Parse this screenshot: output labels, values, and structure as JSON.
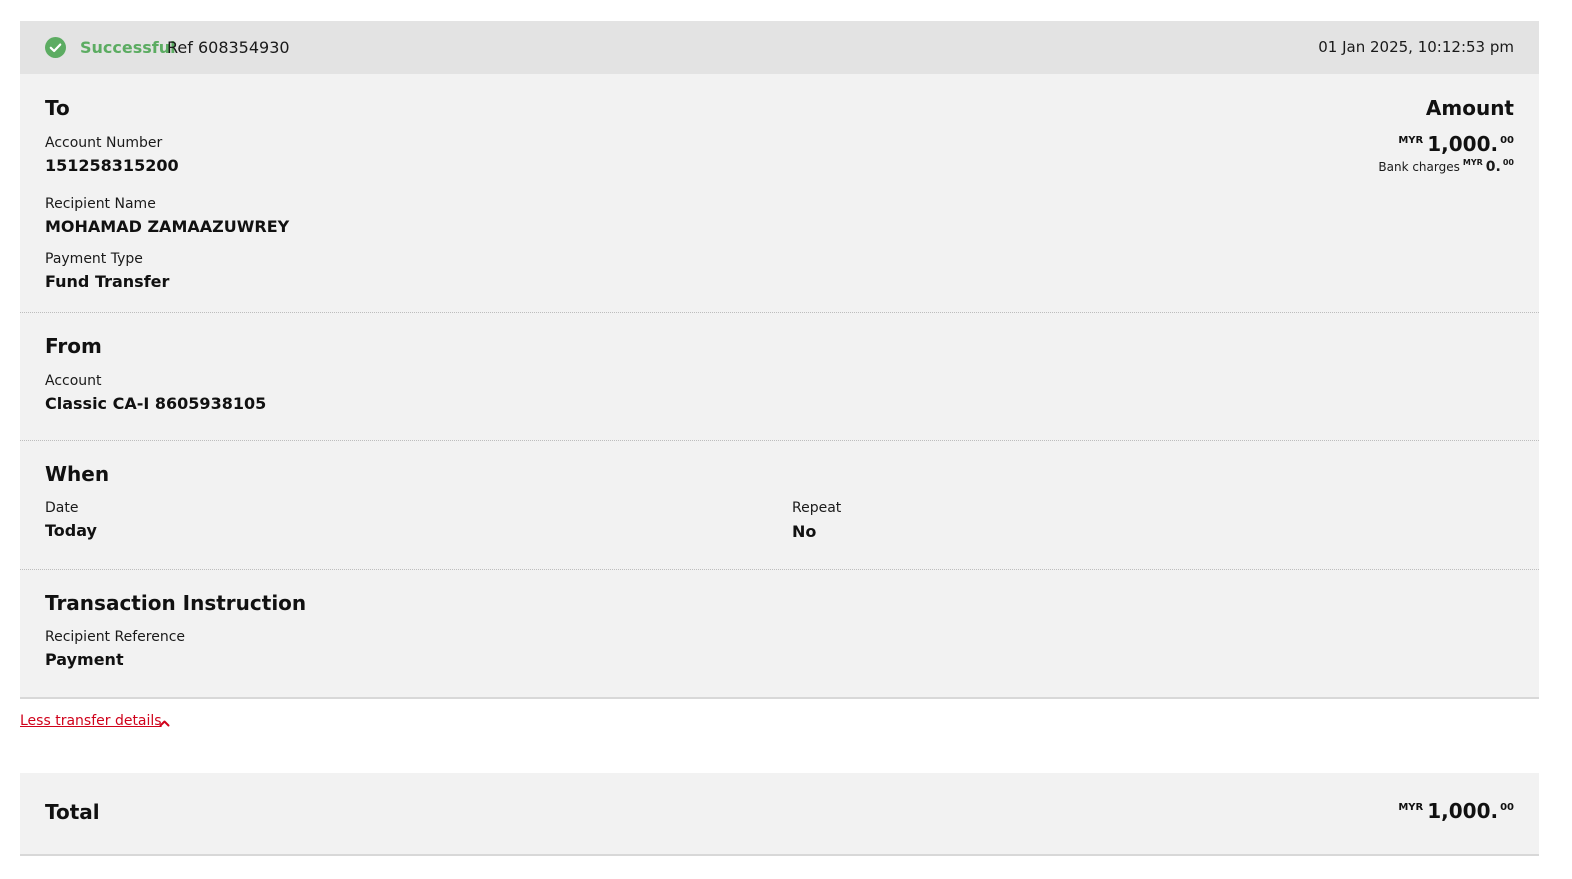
{
  "colors": {
    "success": "#5cac62",
    "link": "#d0021b"
  },
  "header": {
    "status_icon": "check-circle-icon",
    "status": "Successful",
    "ref": "Ref 608354930",
    "timestamp": "01 Jan 2025, 10:12:53 pm"
  },
  "to": {
    "heading": "To",
    "account_number_label": "Account Number",
    "account_number": "151258315200",
    "recipient_name_label": "Recipient Name",
    "recipient_name": "MOHAMAD ZAMAAZUWREY",
    "payment_type_label": "Payment Type",
    "payment_type": "Fund Transfer"
  },
  "amount": {
    "heading": "Amount",
    "currency": "MYR",
    "value_main": "1,000.",
    "value_cents": "00",
    "bank_charges_label": "Bank charges",
    "charges_currency": "MYR",
    "charges_main": "0.",
    "charges_cents": "00"
  },
  "from": {
    "heading": "From",
    "account_label": "Account",
    "account": "Classic CA-I 8605938105"
  },
  "when": {
    "heading": "When",
    "date_label": "Date",
    "date": "Today",
    "repeat_label": "Repeat",
    "repeat": "No"
  },
  "instruction": {
    "heading": "Transaction Instruction",
    "reference_label": "Recipient Reference",
    "reference": "Payment"
  },
  "toggle": {
    "label": "Less transfer details",
    "icon": "chevron-up-icon"
  },
  "total": {
    "label": "Total",
    "currency": "MYR",
    "value_main": "1,000.",
    "value_cents": "00"
  }
}
